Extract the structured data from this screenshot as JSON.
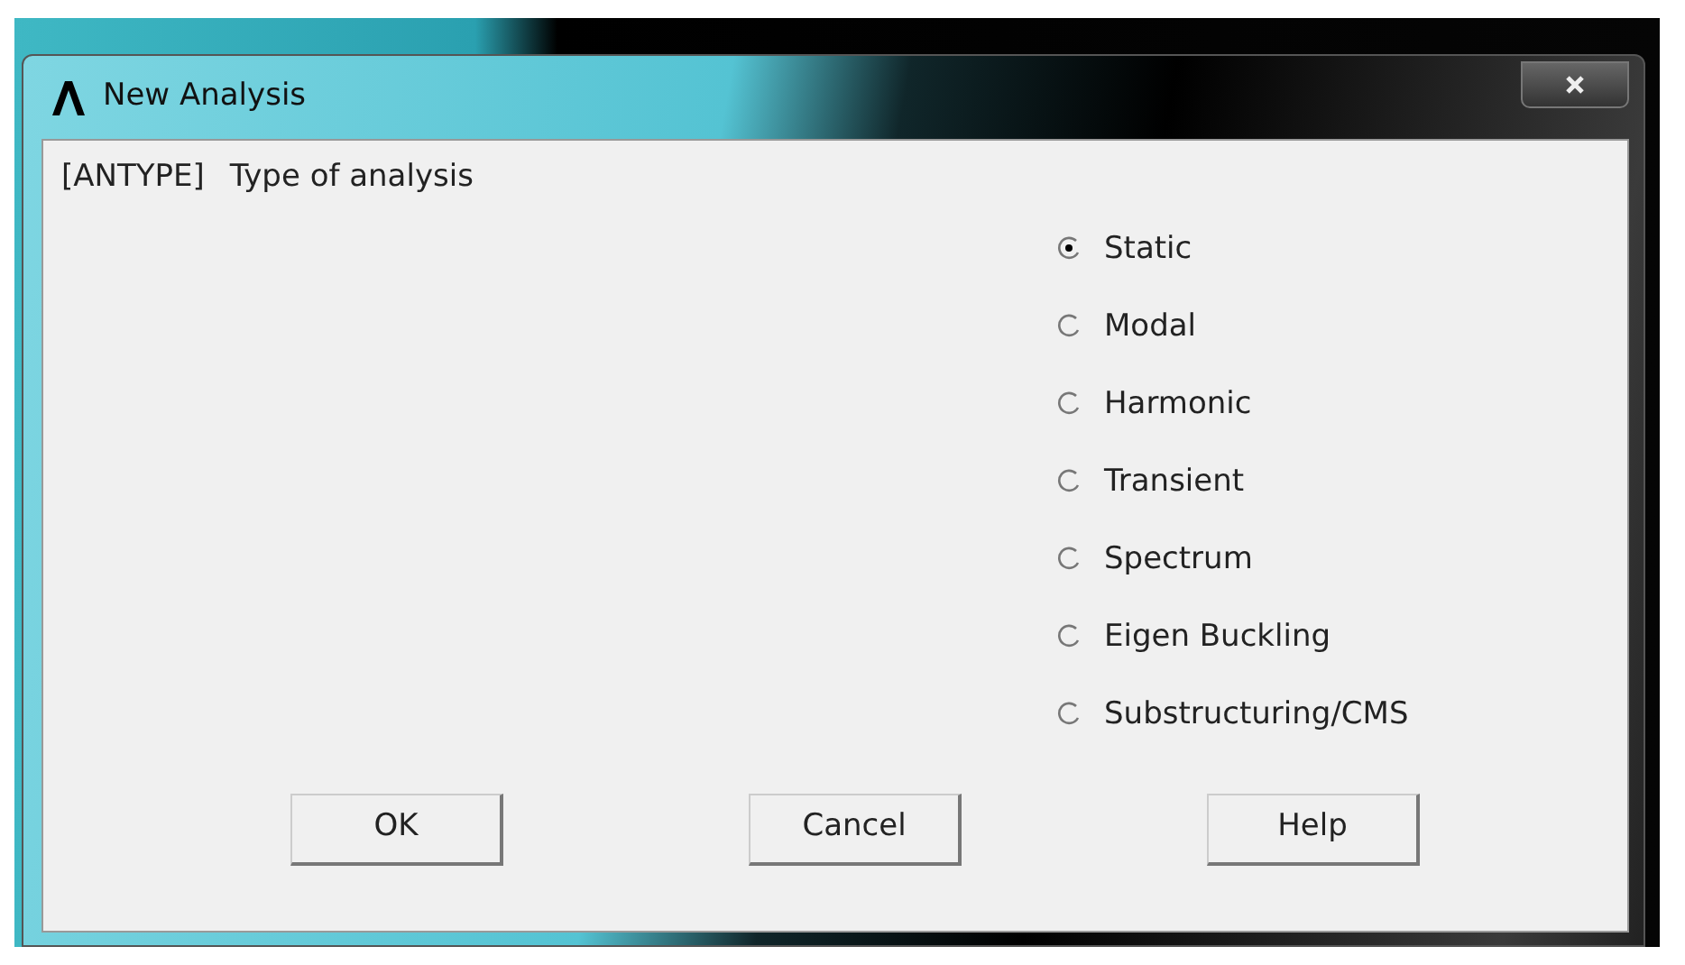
{
  "window": {
    "title": "New Analysis"
  },
  "prompt": {
    "code": "[ANTYPE]",
    "label": "Type of analysis"
  },
  "options": [
    {
      "label": "Static",
      "selected": true
    },
    {
      "label": "Modal",
      "selected": false
    },
    {
      "label": "Harmonic",
      "selected": false
    },
    {
      "label": "Transient",
      "selected": false
    },
    {
      "label": "Spectrum",
      "selected": false
    },
    {
      "label": "Eigen Buckling",
      "selected": false
    },
    {
      "label": "Substructuring/CMS",
      "selected": false
    }
  ],
  "buttons": [
    "OK",
    "Cancel",
    "Help"
  ]
}
